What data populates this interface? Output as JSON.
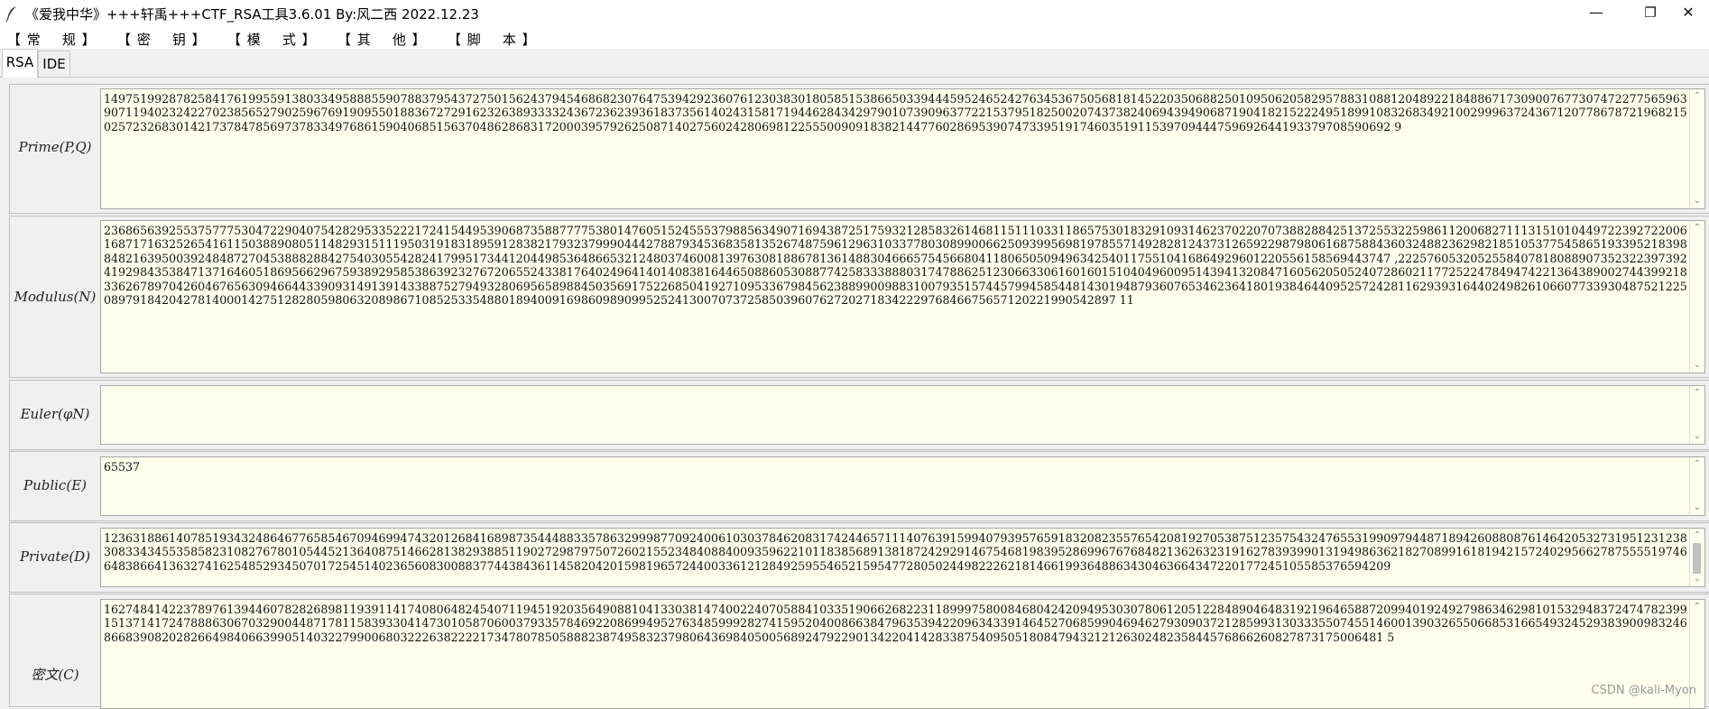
{
  "window": {
    "title": "《爱我中华》+++轩禹+++CTF_RSA工具3.6.01   By:风二西 2022.12.23",
    "minimize": "—",
    "maximize": "❐",
    "close": "✕"
  },
  "menu": [
    "【 常    规 】",
    "【 密    钥 】",
    "【 模    式 】",
    "【 其    他 】",
    "【 脚    本 】"
  ],
  "tabs": [
    "RSA",
    "IDE"
  ],
  "fields": {
    "prime": {
      "label": "Prime(P,Q)",
      "value": "1497519928782584176199559138033495888559078837954372750156243794546868230764753942923607612303830180585153866503394445952465242763453675056818145220350688250109506205829578831088120489221848867173090076773074722775659639071194023242270238565279025967691909550188367272916232638933332436723623936183735614024315817194462843429790107390963772215379518250020743738240694394906871904182152224951899108326834921002999637243671207786787219682150257232683014217378478569737833497686159040685156370486286831720003957926250871402756024280698122555009091838214477602869539074733951917460351911539709444759692644193379708590692 9"
    },
    "modulus": {
      "label": "Modulus(N)",
      "value": "2368656392553757775304722904075428295335222172415449539068735887777538014760515245553798856349071694387251759321285832614681151110331186575301832910931462370220707388288425137255322598611200682711131510104497223927220061687171632526541611503889080511482931511195031918318959128382179323799904442788793453683581352674875961296310337780308990066250939956981978557149282812437312659229879806168758843603248823629821851053775458651933952183988482163950039248487270453888288427540305542824179951734412044985364866532124803746008139763081886781361488304666575456680411806505094963425401175510416864929601220556158569443747 ,222576053205255840781808890735232239739241929843538471371646051869566296759389295853863923276720655243381764024964140140838164465088605308877425833388803174788625123066330616016015104049600951439413208471605620505240728602117725224784947422136438900274439921833626789704260467656309466443390931491391433887527949328069565898845035691752268504192710953367984562388990098831007935157445799458544814301948793607653462364180193846440952572428116293931644024982610660773393048752122508979184204278140001427512828059806320898671085253354880189400916986098909952524130070737258503960762720271834222976846675657120221990542897 11"
    },
    "euler": {
      "label": "Euler(φN)",
      "value": ""
    },
    "public": {
      "label": "Public(E)",
      "value": "65537"
    },
    "private": {
      "label": "Private(D)",
      "value": "1236318861407851934324864677658546709469947432012684168987354448833578632999877092400610303784620831742446571114076391599407939576591832082355765420819270538751235754324765531990979448718942608808761464205327319512312383083343455358582310827678010544521364087514662813829388511902729879750726021552348408840093596221011838568913818724292914675468198395286996767684821362632319162783939901319498636218270899161819421572402956627875555197466483866413632741625485293450701725451402365608300883774438436114582042015981965724400336121284925955465215954772805024498222621814661993648863430463664347220177245105585376594209"
    },
    "cipher": {
      "label": "密文(C)",
      "value": "162748414223789761394460782826898119391141740806482454071194519203564908810413303814740022407058841033519066268223118999758008468042420949530307806120512284890464831921964658872099401924927986346298101532948372474782399151371417247888630670329004487178115839330414730105870600379335784692208699495276348599928274159520400866384796353942209634339146452706859904694627930903721285993130333550745514600139032655066853166549324529383900983246866839082028266498406639905140322799006803222638222217347807850588823874958323798064369840500568924792290134220414283387540950518084794321212630248235844576866260827873175006481 5"
    }
  },
  "watermark": "CSDN @kali-Myon",
  "colors": {
    "field_bg": "#ffffee",
    "window_bg": "#f0f0f0",
    "label_text": "#222222"
  }
}
